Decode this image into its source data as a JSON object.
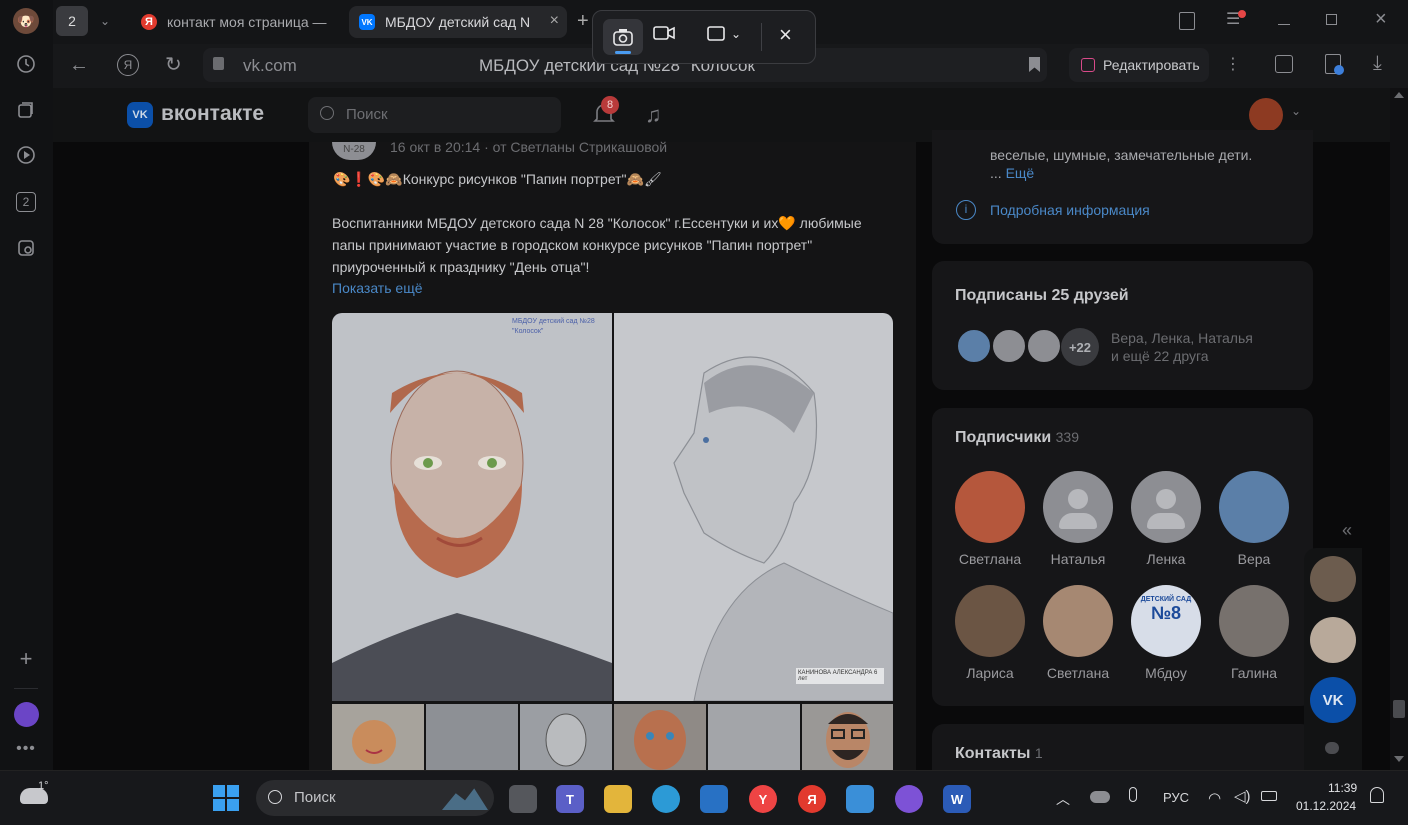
{
  "tabs": {
    "tab_count": "2",
    "tab1_title": "контакт моя страница —",
    "tab2_title": "МБДОУ детский сад N",
    "tab1_favicon": "Я",
    "tab2_favicon": "VK"
  },
  "address": {
    "url": "vk.com",
    "page_title": "МБДОУ детский сад №28 \"Колосок\"",
    "edit_label": "Редактировать"
  },
  "capture_toolbar": {
    "icons": [
      "camera-icon",
      "video-icon",
      "region-select-icon",
      "close-icon"
    ]
  },
  "vk": {
    "logo_text": "вконтакте",
    "search_placeholder": "Поиск",
    "notif_count": "8"
  },
  "post": {
    "author_badge": "N-28",
    "meta": "16 окт в 20:14 · от Светланы Стрикашовой",
    "headline": "🎨❗🎨🙈Конкурс рисунков \"Папин портрет\"🙈🖌",
    "body_line1": "Воспитанники МБДОУ детского сада N 28 \"Колосок\" г.Ессентуки и их🧡 любимые",
    "body_line2": "папы принимают участие в городском конкурсе рисунков \"Папин портрет\"",
    "body_line3": "приуроченный к празднику \"День отца\"!",
    "show_more": "Показать ещё",
    "drawing1_caption": "МБДОУ детский сад №28 \"Колосок\"",
    "drawing2_caption": "КАНИНОВА АЛЕКСАНДРА 6 лет"
  },
  "about": {
    "line": "веселые, шумные, замечательные дети.",
    "more_prefix": "...",
    "more": "Ещё",
    "details": "Подробная информация"
  },
  "friends": {
    "title": "Подписаны 25 друзей",
    "extra_badge": "+22",
    "names": "Вера, Ленка, Наталья",
    "rest": "и ещё 22 друга"
  },
  "subscribers": {
    "title": "Подписчики",
    "count": "339",
    "people": [
      {
        "name": "Светлана",
        "color": "#b5573c"
      },
      {
        "name": "Наталья",
        "color": "#8d8e93"
      },
      {
        "name": "Ленка",
        "color": "#8d8e93"
      },
      {
        "name": "Вера",
        "color": "#5b7fa8"
      },
      {
        "name": "Лариса",
        "color": "#6b5544"
      },
      {
        "name": "Светлана",
        "color": "#a68872"
      },
      {
        "name": "Мбдоу",
        "color": "#d7dde8"
      },
      {
        "name": "Галина",
        "color": "#77716d"
      }
    ],
    "badge_text_top": "ДЕТСКИЙ САД",
    "badge_text_num": "№8"
  },
  "contacts": {
    "title": "Контакты",
    "count": "1"
  },
  "taskbar": {
    "weather": "1°",
    "search": "Поиск",
    "lang": "РУС",
    "time": "11:39",
    "date": "01.12.2024",
    "app_yandex": "Я",
    "app_word": "W"
  },
  "colors": {
    "accent_link": "#4a88c7",
    "badge_red": "#e64646",
    "vk_blue": "#0077ff"
  }
}
